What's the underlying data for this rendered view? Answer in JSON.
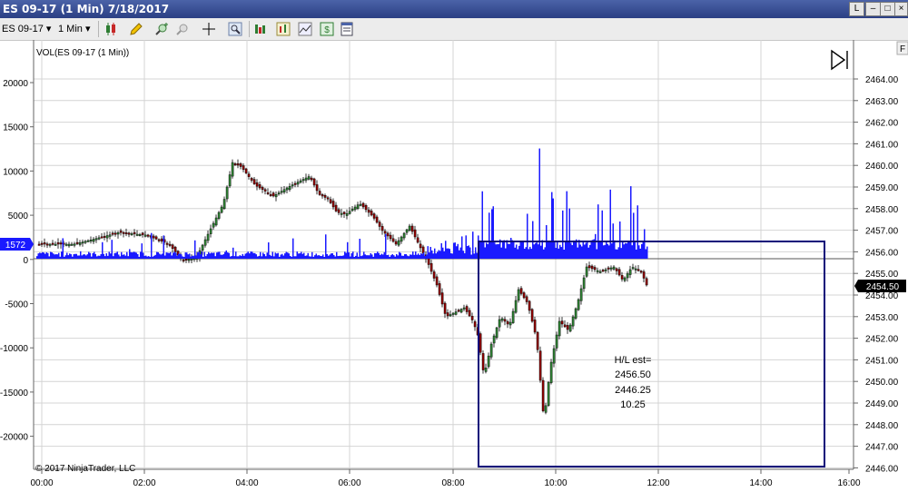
{
  "window": {
    "title": "ES 09-17 (1 Min)  7/18/2017",
    "btn_l": "L",
    "btn_min": "–",
    "btn_max": "□",
    "btn_close": "×"
  },
  "toolbar": {
    "instrument": "ES 09-17",
    "interval": "1 Min",
    "icons": [
      "candlestick-icon",
      "pencil-icon",
      "zoom-in-icon",
      "zoom-out-icon",
      "crosshair-icon",
      "magnify-icon",
      "indicators-icon",
      "strategies-icon",
      "chart-style-icon",
      "dollar-icon",
      "properties-icon"
    ]
  },
  "chart": {
    "indicator_label": "VOL(ES 09-17 (1 Min))",
    "copyright": "© 2017 NinjaTrader, LLC",
    "f_button": "F",
    "left_axis_ticks": [
      "20000",
      "15000",
      "10000",
      "5000",
      "0",
      "-5000",
      "-10000",
      "-15000",
      "-20000"
    ],
    "right_axis_ticks": [
      "2464.00",
      "2463.00",
      "2462.00",
      "2461.00",
      "2460.00",
      "2459.00",
      "2458.00",
      "2457.00",
      "2456.00",
      "2455.00",
      "2454.00",
      "2453.00",
      "2452.00",
      "2451.00",
      "2450.00",
      "2449.00",
      "2448.00",
      "2447.00",
      "2446.00"
    ],
    "x_axis_ticks": [
      "00:00",
      "02:00",
      "04:00",
      "06:00",
      "08:00",
      "10:00",
      "12:00",
      "14:00",
      "16:00"
    ],
    "volume_marker": "1572",
    "price_marker": "2454.50",
    "annotation": [
      "H/L est=",
      "2456.50",
      "2446.25",
      "10.25"
    ],
    "colors": {
      "volume": "#1a1aff",
      "box": "#0a0a7a",
      "up": "#2e7d32",
      "down": "#8b0000",
      "grid": "#d4d4d4"
    }
  }
}
